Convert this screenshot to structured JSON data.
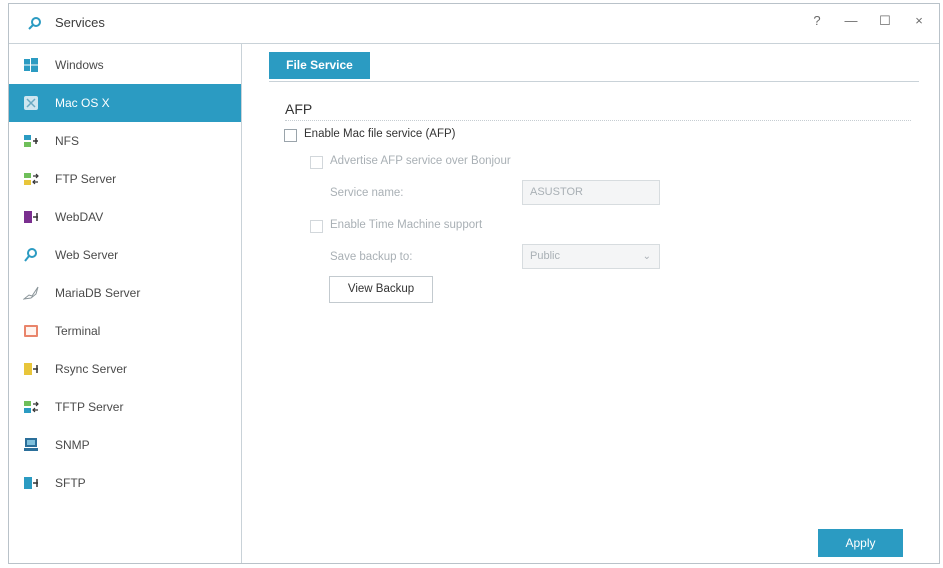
{
  "window": {
    "title": "Services",
    "icon": "services-icon",
    "controls": {
      "help": "?",
      "minimize": "—",
      "maximize": "☐",
      "close": "×"
    }
  },
  "sidebar": {
    "items": [
      {
        "label": "Windows",
        "icon": "windows-icon",
        "active": false
      },
      {
        "label": "Mac OS X",
        "icon": "mac-icon",
        "active": true
      },
      {
        "label": "NFS",
        "icon": "nfs-icon",
        "active": false
      },
      {
        "label": "FTP Server",
        "icon": "ftp-icon",
        "active": false
      },
      {
        "label": "WebDAV",
        "icon": "webdav-icon",
        "active": false
      },
      {
        "label": "Web Server",
        "icon": "web-server-icon",
        "active": false
      },
      {
        "label": "MariaDB Server",
        "icon": "mariadb-icon",
        "active": false
      },
      {
        "label": "Terminal",
        "icon": "terminal-icon",
        "active": false
      },
      {
        "label": "Rsync Server",
        "icon": "rsync-icon",
        "active": false
      },
      {
        "label": "TFTP Server",
        "icon": "tftp-icon",
        "active": false
      },
      {
        "label": "SNMP",
        "icon": "snmp-icon",
        "active": false
      },
      {
        "label": "SFTP",
        "icon": "sftp-icon",
        "active": false
      }
    ]
  },
  "main": {
    "tab_label": "File Service",
    "section_title": "AFP",
    "enable_afp_label": "Enable Mac file service (AFP)",
    "advertise_label": "Advertise AFP service over Bonjour",
    "service_name_label": "Service name:",
    "service_name_value": "ASUSTOR",
    "time_machine_label": "Enable Time Machine support",
    "save_backup_label": "Save backup to:",
    "save_backup_value": "Public",
    "view_backup_label": "View Backup",
    "apply_label": "Apply"
  },
  "colors": {
    "accent": "#2b9bc2"
  }
}
